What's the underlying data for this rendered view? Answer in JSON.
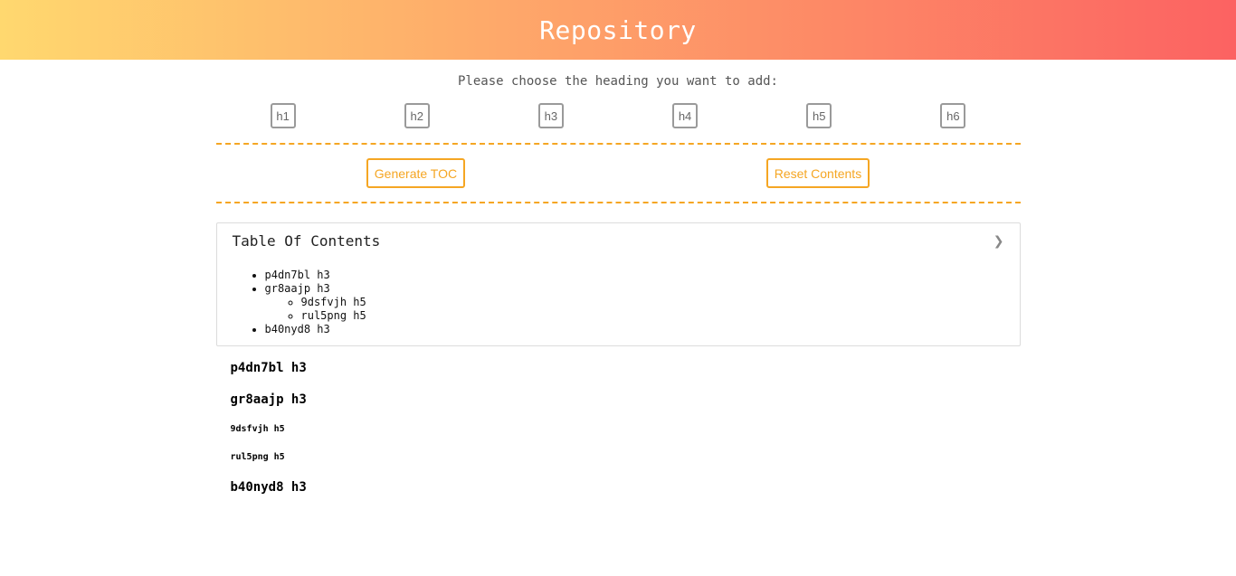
{
  "header": {
    "title": "Repository"
  },
  "prompt": "Please choose the heading you want to add:",
  "heading_buttons": [
    "h1",
    "h2",
    "h3",
    "h4",
    "h5",
    "h6"
  ],
  "actions": {
    "generate_label": "Generate TOC",
    "reset_label": "Reset Contents"
  },
  "toc": {
    "title": "Table Of Contents",
    "toggle_icon": "❯",
    "items": [
      {
        "label": "p4dn7bl h3"
      },
      {
        "label": "gr8aajp h3",
        "children": [
          "9dsfvjh h5",
          "rul5png h5"
        ]
      },
      {
        "label": "b40nyd8 h3"
      }
    ]
  },
  "content": [
    {
      "level": "h3",
      "text": "p4dn7bl h3"
    },
    {
      "level": "h3",
      "text": "gr8aajp h3"
    },
    {
      "level": "h5",
      "text": "9dsfvjh h5"
    },
    {
      "level": "h5",
      "text": "rul5png h5"
    },
    {
      "level": "h3",
      "text": "b40nyd8 h3"
    }
  ],
  "colors": {
    "gradient_start": "#ffd86f",
    "gradient_end": "#fc6262",
    "accent": "#f5a623"
  }
}
